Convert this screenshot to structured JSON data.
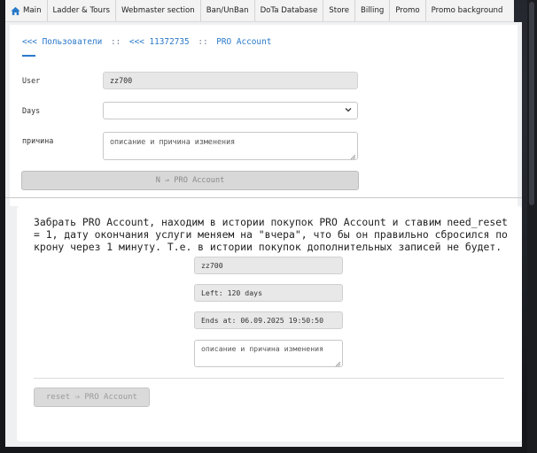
{
  "nav": {
    "items": [
      "Main",
      "Ladder & Tours",
      "Webmaster section",
      "Ban/UnBan",
      "DoTa Database",
      "Store",
      "Billing",
      "Promo",
      "Promo background"
    ],
    "icon": "home-icon",
    "accent": "#2a79c9"
  },
  "breadcrumb": {
    "users": "<<< Пользователи",
    "sep1": "::",
    "user_id": "<<< 11372735",
    "sep2": "::",
    "current": "PRO Account"
  },
  "form": {
    "user_label": "User",
    "user_value": "zz700",
    "days_label": "Days",
    "days_value": "",
    "reason_label": "причина",
    "reason_placeholder": "описание и причина изменения",
    "submit_label": "N ⇒ PRO Account"
  },
  "reset_section": {
    "description": "Забрать PRO Account, находим в истории покупок PRO Account и ставим need_reset = 1, дату окончания услуги меняем на \"вчера\", что бы он правильно сбросился по крону через 1 минуту. Т.е. в истории покупок дополнительных записей не будет.",
    "user_value": "zz700",
    "left_value": "Left: 120 days",
    "ends_value": "Ends at: 06.09.2025 19:50:50",
    "reason_placeholder": "описание и причина изменения",
    "reset_label": "reset ⇒ PRO Account"
  }
}
